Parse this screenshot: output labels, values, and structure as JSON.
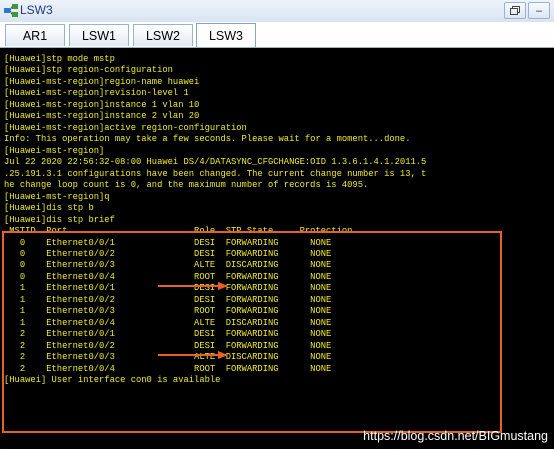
{
  "window": {
    "title": "LSW3"
  },
  "tabs": [
    {
      "label": "AR1",
      "active": false
    },
    {
      "label": "LSW1",
      "active": false
    },
    {
      "label": "LSW2",
      "active": false
    },
    {
      "label": "LSW3",
      "active": true
    }
  ],
  "window_controls": {
    "restore_icon": "restore-icon",
    "minimize_label": "–"
  },
  "terminal": {
    "lines": [
      "[Huawei]stp mode mstp",
      "[Huawei]stp region-configuration",
      "[Huawei-mst-region]region-name huawei",
      "[Huawei-mst-region]revision-level 1",
      "[Huawei-mst-region]instance 1 vlan 10",
      "[Huawei-mst-region]instance 2 vlan 20",
      "[Huawei-mst-region]active region-configuration",
      "Info: This operation may take a few seconds. Please wait for a moment...done.",
      "[Huawei-mst-region]",
      "Jul 22 2020 22:56:32-08:00 Huawei DS/4/DATASYNC_CFGCHANGE:OID 1.3.6.1.4.1.2011.5",
      ".25.191.3.1 configurations have been changed. The current change number is 13, t",
      "he change loop count is 0, and the maximum number of records is 4095.",
      "[Huawei-mst-region]q",
      "[Huawei]dis stp b",
      "[Huawei]dis stp brief",
      " MSTID  Port                        Role  STP State     Protection",
      "   0    Ethernet0/0/1               DESI  FORWARDING      NONE",
      "   0    Ethernet0/0/2               DESI  FORWARDING      NONE",
      "   0    Ethernet0/0/3               ALTE  DISCARDING      NONE",
      "   0    Ethernet0/0/4               ROOT  FORWARDING      NONE",
      "   1    Ethernet0/0/1               DESI  FORWARDING      NONE",
      "   1    Ethernet0/0/2               DESI  FORWARDING      NONE",
      "   1    Ethernet0/0/3               ROOT  FORWARDING      NONE",
      "   1    Ethernet0/0/4               ALTE  DISCARDING      NONE",
      "   2    Ethernet0/0/1               DESI  FORWARDING      NONE",
      "   2    Ethernet0/0/2               DESI  FORWARDING      NONE",
      "   2    Ethernet0/0/3               ALTE  DISCARDING      NONE",
      "   2    Ethernet0/0/4               ROOT  FORWARDING      NONE",
      "[Huawei] User interface con0 is available"
    ],
    "highlight_color": "#e5602a",
    "text_color": "#f0ea2c"
  },
  "watermark": "https://blog.csdn.net/BIGmustang"
}
